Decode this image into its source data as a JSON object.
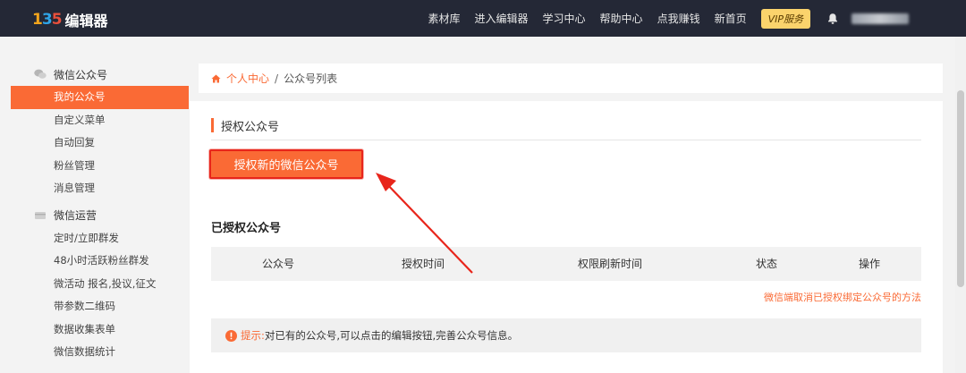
{
  "header": {
    "logo_mark": [
      "1",
      "3",
      "5"
    ],
    "logo_text": "编辑器",
    "nav": [
      "素材库",
      "进入编辑器",
      "学习中心",
      "帮助中心",
      "点我赚钱",
      "新首页"
    ],
    "vip_label": "VIP服务",
    "bg_color": "#242836"
  },
  "sidebar": {
    "groups": [
      {
        "label": "微信公众号",
        "icon": "wechat-icon",
        "items": [
          "我的公众号",
          "自定义菜单",
          "自动回复",
          "粉丝管理",
          "消息管理"
        ]
      },
      {
        "label": "微信运营",
        "icon": "card-icon",
        "items": [
          "定时/立即群发",
          "48小时活跃粉丝群发",
          "微活动 报名,投议,征文",
          "带参数二维码",
          "数据收集表单",
          "微信数据统计"
        ]
      }
    ],
    "active_item": "我的公众号",
    "accent": "#fa6a35"
  },
  "breadcrumb": {
    "home_label": "个人中心",
    "separator": "/",
    "current": "公众号列表"
  },
  "main": {
    "section_title": "授权公众号",
    "authorize_button": "授权新的微信公众号",
    "authorized_title": "已授权公众号",
    "table_headers": [
      "公众号",
      "授权时间",
      "权限刷新时间",
      "状态",
      "操作"
    ],
    "help_link": "微信端取消已授权绑定公众号的方法",
    "notice_label": "提示:",
    "notice_text": "对已有的公众号,可以点击的编辑按钮,完善公众号信息。"
  }
}
